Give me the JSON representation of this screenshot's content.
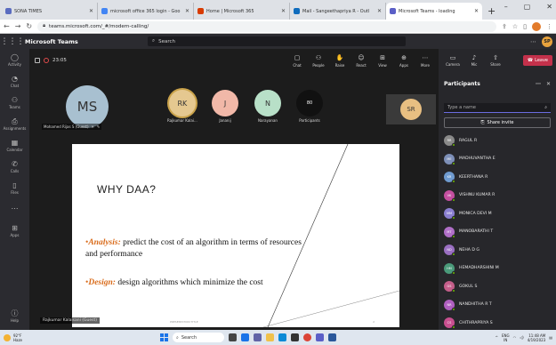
{
  "browser": {
    "tabs": [
      {
        "label": "SONA TIMES",
        "color": "#5a6cc0",
        "active": false
      },
      {
        "label": "microsoft office 365 login - Goo",
        "color": "#4285f4",
        "active": false
      },
      {
        "label": "Home | Microsoft 365",
        "color": "#d83b01",
        "active": false
      },
      {
        "label": "Mail - Sangeethapriya R - Outl",
        "color": "#0f6cbd",
        "active": false
      },
      {
        "label": "Microsoft Teams - loading",
        "color": "#5b5fc7",
        "active": true
      }
    ],
    "new_tab": "+",
    "url": "teams.microsoft.com/_#/modern-calling/"
  },
  "teams": {
    "app_name": "Microsoft Teams",
    "search_placeholder": "Search",
    "user_initials": "SP",
    "rail": [
      {
        "icon": "bell-icon",
        "glyph": "◯",
        "label": "Activity"
      },
      {
        "icon": "chat-icon",
        "glyph": "◔",
        "label": "Chat"
      },
      {
        "icon": "teams-icon",
        "glyph": "⚇",
        "label": "Teams"
      },
      {
        "icon": "assignments-icon",
        "glyph": "⎙",
        "label": "Assignments"
      },
      {
        "icon": "calendar-icon",
        "glyph": "▦",
        "label": "Calendar"
      },
      {
        "icon": "calls-icon",
        "glyph": "✆",
        "label": "Calls"
      },
      {
        "icon": "files-icon",
        "glyph": "▯",
        "label": "Files"
      },
      {
        "icon": "more-icon",
        "glyph": "⋯",
        "label": ""
      },
      {
        "icon": "apps-icon",
        "glyph": "⊞",
        "label": "Apps"
      }
    ],
    "help_label": "Help"
  },
  "meeting": {
    "timer": "23:05",
    "controls": [
      {
        "icon": "chat-icon",
        "glyph": "▢",
        "label": "Chat"
      },
      {
        "icon": "people-icon",
        "glyph": "⚇",
        "label": "People"
      },
      {
        "icon": "raise-hand-icon",
        "glyph": "✋",
        "label": "Raise"
      },
      {
        "icon": "react-icon",
        "glyph": "☺",
        "label": "React"
      },
      {
        "icon": "view-icon",
        "glyph": "⊞",
        "label": "View"
      },
      {
        "icon": "apps-icon",
        "glyph": "⊕",
        "label": "Apps"
      },
      {
        "icon": "more-icon",
        "glyph": "⋯",
        "label": "More"
      }
    ],
    "panel_controls": [
      {
        "icon": "camera-icon",
        "glyph": "▭",
        "label": "Camera"
      },
      {
        "icon": "mic-icon",
        "glyph": "♪",
        "label": "Mic"
      },
      {
        "icon": "share-icon",
        "glyph": "⇧",
        "label": "Share"
      }
    ],
    "leave_label": "Leave",
    "main_tile": {
      "initials": "MS",
      "name": "Mohamed Rijas S (Guest)"
    },
    "participants_strip": [
      {
        "initials": "RK",
        "name": "Rajkumar Kalai...",
        "color": "#e5c890",
        "ring": true
      },
      {
        "initials": "J",
        "name": "Jananij",
        "color": "#f1b8a8",
        "ring": false
      },
      {
        "initials": "N",
        "name": "Narayanan",
        "color": "#b8e0c8",
        "ring": false
      },
      {
        "initials": "80",
        "name": "Participants",
        "color": "#111111",
        "ring": false
      }
    ],
    "self_tile": {
      "initials": "SR"
    },
    "presenter": "Rajkumar Kalaisani (Guest)",
    "slide": {
      "title": "WHY DAA?",
      "bullet1_keyword": "Analysis:",
      "bullet1_text": " predict the cost of an algorithm in terms of resources and performance",
      "bullet2_keyword": "Design:",
      "bullet2_text": " design algorithms which minimize the cost",
      "footer": "PRESENTATION TITLE",
      "number": "2"
    }
  },
  "participants": {
    "title": "Participants",
    "search_placeholder": "Type a name",
    "share_invite": "Share invite",
    "list": [
      {
        "name": "RAGUL R",
        "initials": "RR",
        "color": "#8a8a8a"
      },
      {
        "name": "MADHUVANTHA E",
        "initials": "ME",
        "color": "#7d8fb8"
      },
      {
        "name": "KEERTHANA R",
        "initials": "KR",
        "color": "#6f9bd0"
      },
      {
        "name": "VISHNU KUMAR R",
        "initials": "VK",
        "color": "#c44fa0"
      },
      {
        "name": "MONICA DEVI M",
        "initials": "MM",
        "color": "#8a7fd0"
      },
      {
        "name": "MANOBARATHI T",
        "initials": "MT",
        "color": "#b06fc8"
      },
      {
        "name": "NEHA D G",
        "initials": "ND",
        "color": "#9a6fc2"
      },
      {
        "name": "HEMADHARSHINI M",
        "initials": "HM",
        "color": "#4a9a7a"
      },
      {
        "name": "GOKUL S",
        "initials": "GS",
        "color": "#c45e8a"
      },
      {
        "name": "NANDHITHA R T",
        "initials": "NR",
        "color": "#b05fc0"
      },
      {
        "name": "CHITHRAPRIYA S",
        "initials": "CS",
        "color": "#c84f8f"
      }
    ]
  },
  "taskbar": {
    "temp": "92°F",
    "condition": "Haze",
    "search": "Search",
    "lang_top": "ENG",
    "lang_bottom": "IN",
    "time": "11:48 AM",
    "date": "4/19/2023"
  }
}
